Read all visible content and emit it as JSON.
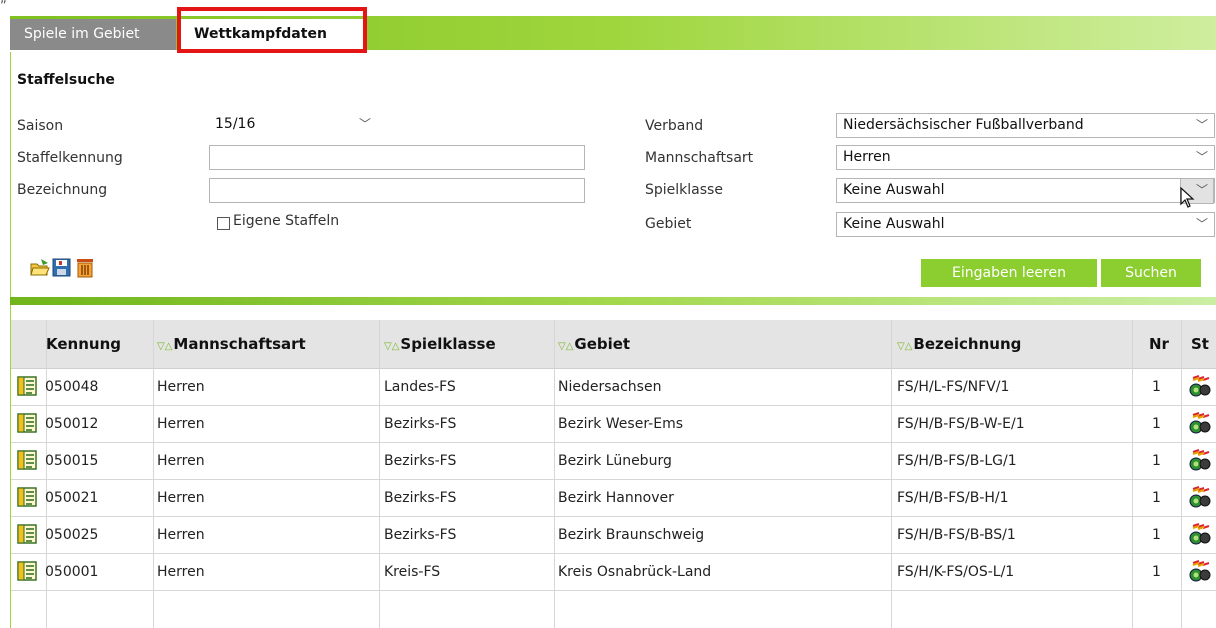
{
  "top_fragment": "„",
  "tabs": [
    {
      "label": "Spiele im Gebiet",
      "active": false
    },
    {
      "label": "Wettkampfdaten",
      "active": true
    }
  ],
  "form": {
    "title": "Staffelsuche",
    "saison_label": "Saison",
    "saison_value": "15/16",
    "staffelkennung_label": "Staffelkennung",
    "staffelkennung_value": "",
    "bezeichnung_label": "Bezeichnung",
    "bezeichnung_value": "",
    "eigene_staffeln_label": "Eigene Staffeln",
    "verband_label": "Verband",
    "verband_value": "Niedersächsischer Fußballverband",
    "mannschaftsart_label": "Mannschaftsart",
    "mannschaftsart_value": "Herren",
    "spielklasse_label": "Spielklasse",
    "spielklasse_value": "Keine Auswahl",
    "gebiet_label": "Gebiet",
    "gebiet_value": "Keine Auswahl",
    "clear_button": "Eingaben leeren",
    "search_button": "Suchen",
    "toolbar_icons": [
      "open-folder-icon",
      "save-disk-icon",
      "delete-trash-icon"
    ]
  },
  "table": {
    "sort_marker": "▽△",
    "columns": {
      "kennung": "Kennung",
      "mannschaftsart": "Mannschaftsart",
      "spielklasse": "Spielklasse",
      "gebiet": "Gebiet",
      "bezeichnung": "Bezeichnung",
      "nr": "Nr",
      "st": "St"
    },
    "rows": [
      {
        "kennung": "050048",
        "mannschaftsart": "Herren",
        "spielklasse": "Landes-FS",
        "gebiet": "Niedersachsen",
        "bezeichnung": "FS/H/L-FS/NFV/1",
        "nr": "1"
      },
      {
        "kennung": "050012",
        "mannschaftsart": "Herren",
        "spielklasse": "Bezirks-FS",
        "gebiet": "Bezirk Weser-Ems",
        "bezeichnung": "FS/H/B-FS/B-W-E/1",
        "nr": "1"
      },
      {
        "kennung": "050015",
        "mannschaftsart": "Herren",
        "spielklasse": "Bezirks-FS",
        "gebiet": "Bezirk Lüneburg",
        "bezeichnung": "FS/H/B-FS/B-LG/1",
        "nr": "1"
      },
      {
        "kennung": "050021",
        "mannschaftsart": "Herren",
        "spielklasse": "Bezirks-FS",
        "gebiet": "Bezirk Hannover",
        "bezeichnung": "FS/H/B-FS/B-H/1",
        "nr": "1"
      },
      {
        "kennung": "050025",
        "mannschaftsart": "Herren",
        "spielklasse": "Bezirks-FS",
        "gebiet": "Bezirk Braunschweig",
        "bezeichnung": "FS/H/B-FS/B-BS/1",
        "nr": "1"
      },
      {
        "kennung": "050001",
        "mannschaftsart": "Herren",
        "spielklasse": "Kreis-FS",
        "gebiet": "Kreis Osnabrück-Land",
        "bezeichnung": "FS/H/K-FS/OS-L/1",
        "nr": "1"
      }
    ]
  },
  "colors": {
    "accent_green": "#8ccd2f",
    "tab_inactive": "#8a8a8a",
    "highlight_red": "#e31515"
  }
}
